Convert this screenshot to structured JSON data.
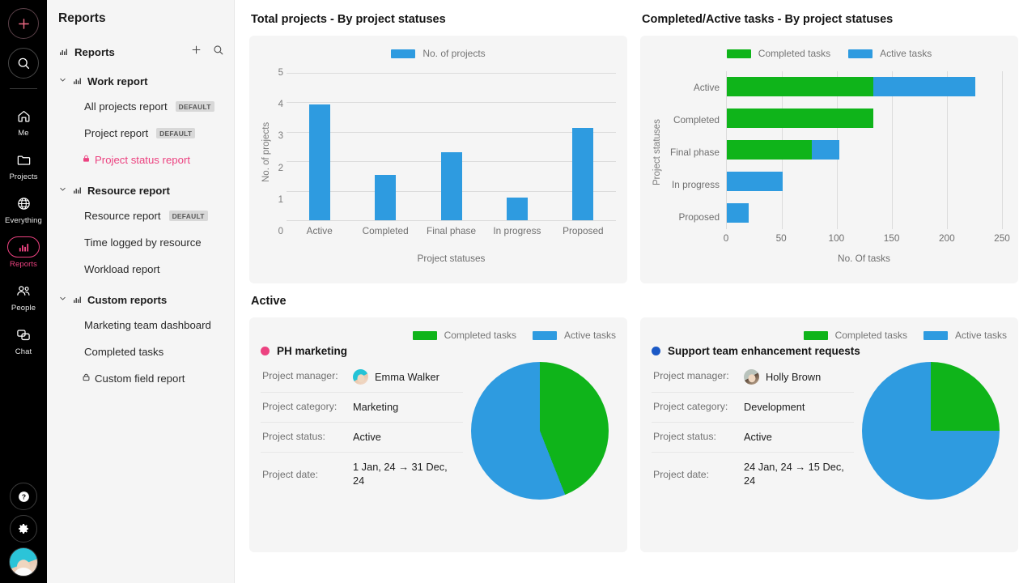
{
  "colors": {
    "blue": "#2e9be0",
    "green": "#0fb41a",
    "pink": "#ec4280",
    "dark_blue": "#1b59c6",
    "rail_bg": "#000000",
    "sidebar_bg": "#f5f5f5",
    "card_bg": "#f5f5f5"
  },
  "rail": {
    "add_icon": "plus-icon",
    "search_icon": "search-icon",
    "items": [
      {
        "label": "Me",
        "icon": "home-icon",
        "active": false
      },
      {
        "label": "Projects",
        "icon": "folder-icon",
        "active": false
      },
      {
        "label": "Everything",
        "icon": "globe-icon",
        "active": false
      },
      {
        "label": "Reports",
        "icon": "bar-chart-icon",
        "active": true
      },
      {
        "label": "People",
        "icon": "people-icon",
        "active": false
      },
      {
        "label": "Chat",
        "icon": "chat-icon",
        "active": false
      }
    ],
    "bottom": [
      {
        "icon": "help-icon"
      },
      {
        "icon": "settings-gear-icon"
      },
      {
        "icon": "user-avatar"
      }
    ]
  },
  "sidebar": {
    "title": "Reports",
    "root": {
      "label": "Reports",
      "add_icon": "plus-icon",
      "search_icon": "search-icon"
    },
    "groups": [
      {
        "label": "Work report",
        "expanded": true,
        "items": [
          {
            "label": "All projects report",
            "badge": "DEFAULT",
            "locked": false,
            "selected": false
          },
          {
            "label": "Project report",
            "badge": "DEFAULT",
            "locked": false,
            "selected": false
          },
          {
            "label": "Project status report",
            "badge": "",
            "locked": true,
            "selected": true
          }
        ]
      },
      {
        "label": "Resource report",
        "expanded": true,
        "items": [
          {
            "label": "Resource report",
            "badge": "DEFAULT",
            "locked": false,
            "selected": false
          },
          {
            "label": "Time logged by resource",
            "badge": "",
            "locked": false,
            "selected": false
          },
          {
            "label": "Workload report",
            "badge": "",
            "locked": false,
            "selected": false
          }
        ]
      },
      {
        "label": "Custom reports",
        "expanded": true,
        "items": [
          {
            "label": "Marketing team dashboard",
            "badge": "",
            "locked": false,
            "selected": false
          },
          {
            "label": "Completed tasks",
            "badge": "",
            "locked": false,
            "selected": false
          },
          {
            "label": "Custom field report",
            "badge": "",
            "locked": true,
            "selected": false
          }
        ]
      }
    ]
  },
  "main": {
    "chart1_title": "Total projects - By project statuses",
    "chart2_title": "Completed/Active tasks - By project statuses",
    "section_title": "Active"
  },
  "chart_data": [
    {
      "type": "bar",
      "title": "Total projects - By project statuses",
      "categories": [
        "Active",
        "Completed",
        "Final phase",
        "In progress",
        "Proposed"
      ],
      "values": [
        3.92,
        1.53,
        2.32,
        0.76,
        3.13
      ],
      "series": [
        {
          "name": "No. of projects",
          "values": [
            3.92,
            1.53,
            2.32,
            0.76,
            3.13
          ],
          "color": "#2e9be0"
        }
      ],
      "legend": [
        "No. of projects"
      ],
      "legend_position": "top-center",
      "xlabel": "Project statuses",
      "ylabel": "No. of projects",
      "ylim": [
        0,
        5
      ],
      "yticks": [
        0,
        1,
        2,
        3,
        4,
        5
      ],
      "grid": true
    },
    {
      "type": "bar",
      "orientation": "horizontal",
      "stacked": true,
      "title": "Completed/Active tasks - By project statuses",
      "categories": [
        "Active",
        "Completed",
        "Final phase",
        "In progress",
        "Proposed"
      ],
      "series": [
        {
          "name": "Completed tasks",
          "values": [
            133,
            133,
            77,
            0,
            0
          ],
          "color": "#0fb41a"
        },
        {
          "name": "Active tasks",
          "values": [
            93,
            0,
            25,
            51,
            20
          ],
          "color": "#2e9be0"
        }
      ],
      "legend": [
        "Completed tasks",
        "Active tasks"
      ],
      "legend_position": "top-center",
      "xlabel": "No. Of tasks",
      "ylabel": "Project statuses",
      "xlim": [
        0,
        250
      ],
      "xticks": [
        0,
        50,
        100,
        150,
        200,
        250
      ],
      "grid": true
    },
    {
      "type": "pie",
      "title": "PH marketing",
      "labels": [
        "Completed tasks",
        "Active tasks"
      ],
      "values": [
        44,
        56
      ],
      "colors": [
        "#0fb41a",
        "#2e9be0"
      ],
      "legend": [
        "Completed tasks",
        "Active tasks"
      ],
      "legend_position": "top-right"
    },
    {
      "type": "pie",
      "title": "Support team enhancement requests",
      "labels": [
        "Completed tasks",
        "Active tasks"
      ],
      "values": [
        25,
        75
      ],
      "colors": [
        "#0fb41a",
        "#2e9be0"
      ],
      "legend": [
        "Completed tasks",
        "Active tasks"
      ],
      "legend_position": "top-right"
    }
  ],
  "project_cards": [
    {
      "name": "PH marketing",
      "dot_color": "#ec4280",
      "legend": [
        {
          "label": "Completed tasks",
          "color": "#0fb41a"
        },
        {
          "label": "Active tasks",
          "color": "#2e9be0"
        }
      ],
      "fields": [
        {
          "key": "Project manager:",
          "value": "Emma Walker",
          "avatar": "teal"
        },
        {
          "key": "Project category:",
          "value": "Marketing",
          "avatar": ""
        },
        {
          "key": "Project status:",
          "value": "Active",
          "avatar": ""
        },
        {
          "key": "Project date:",
          "value": "1 Jan, 24 → 31 Dec, 24",
          "avatar": ""
        }
      ]
    },
    {
      "name": "Support team enhancement requests",
      "dot_color": "#1b59c6",
      "legend": [
        {
          "label": "Completed tasks",
          "color": "#0fb41a"
        },
        {
          "label": "Active tasks",
          "color": "#2e9be0"
        }
      ],
      "fields": [
        {
          "key": "Project manager:",
          "value": "Holly Brown",
          "avatar": "grey"
        },
        {
          "key": "Project category:",
          "value": "Development",
          "avatar": ""
        },
        {
          "key": "Project status:",
          "value": "Active",
          "avatar": ""
        },
        {
          "key": "Project date:",
          "value": "24 Jan, 24 → 15 Dec, 24",
          "avatar": ""
        }
      ]
    }
  ]
}
